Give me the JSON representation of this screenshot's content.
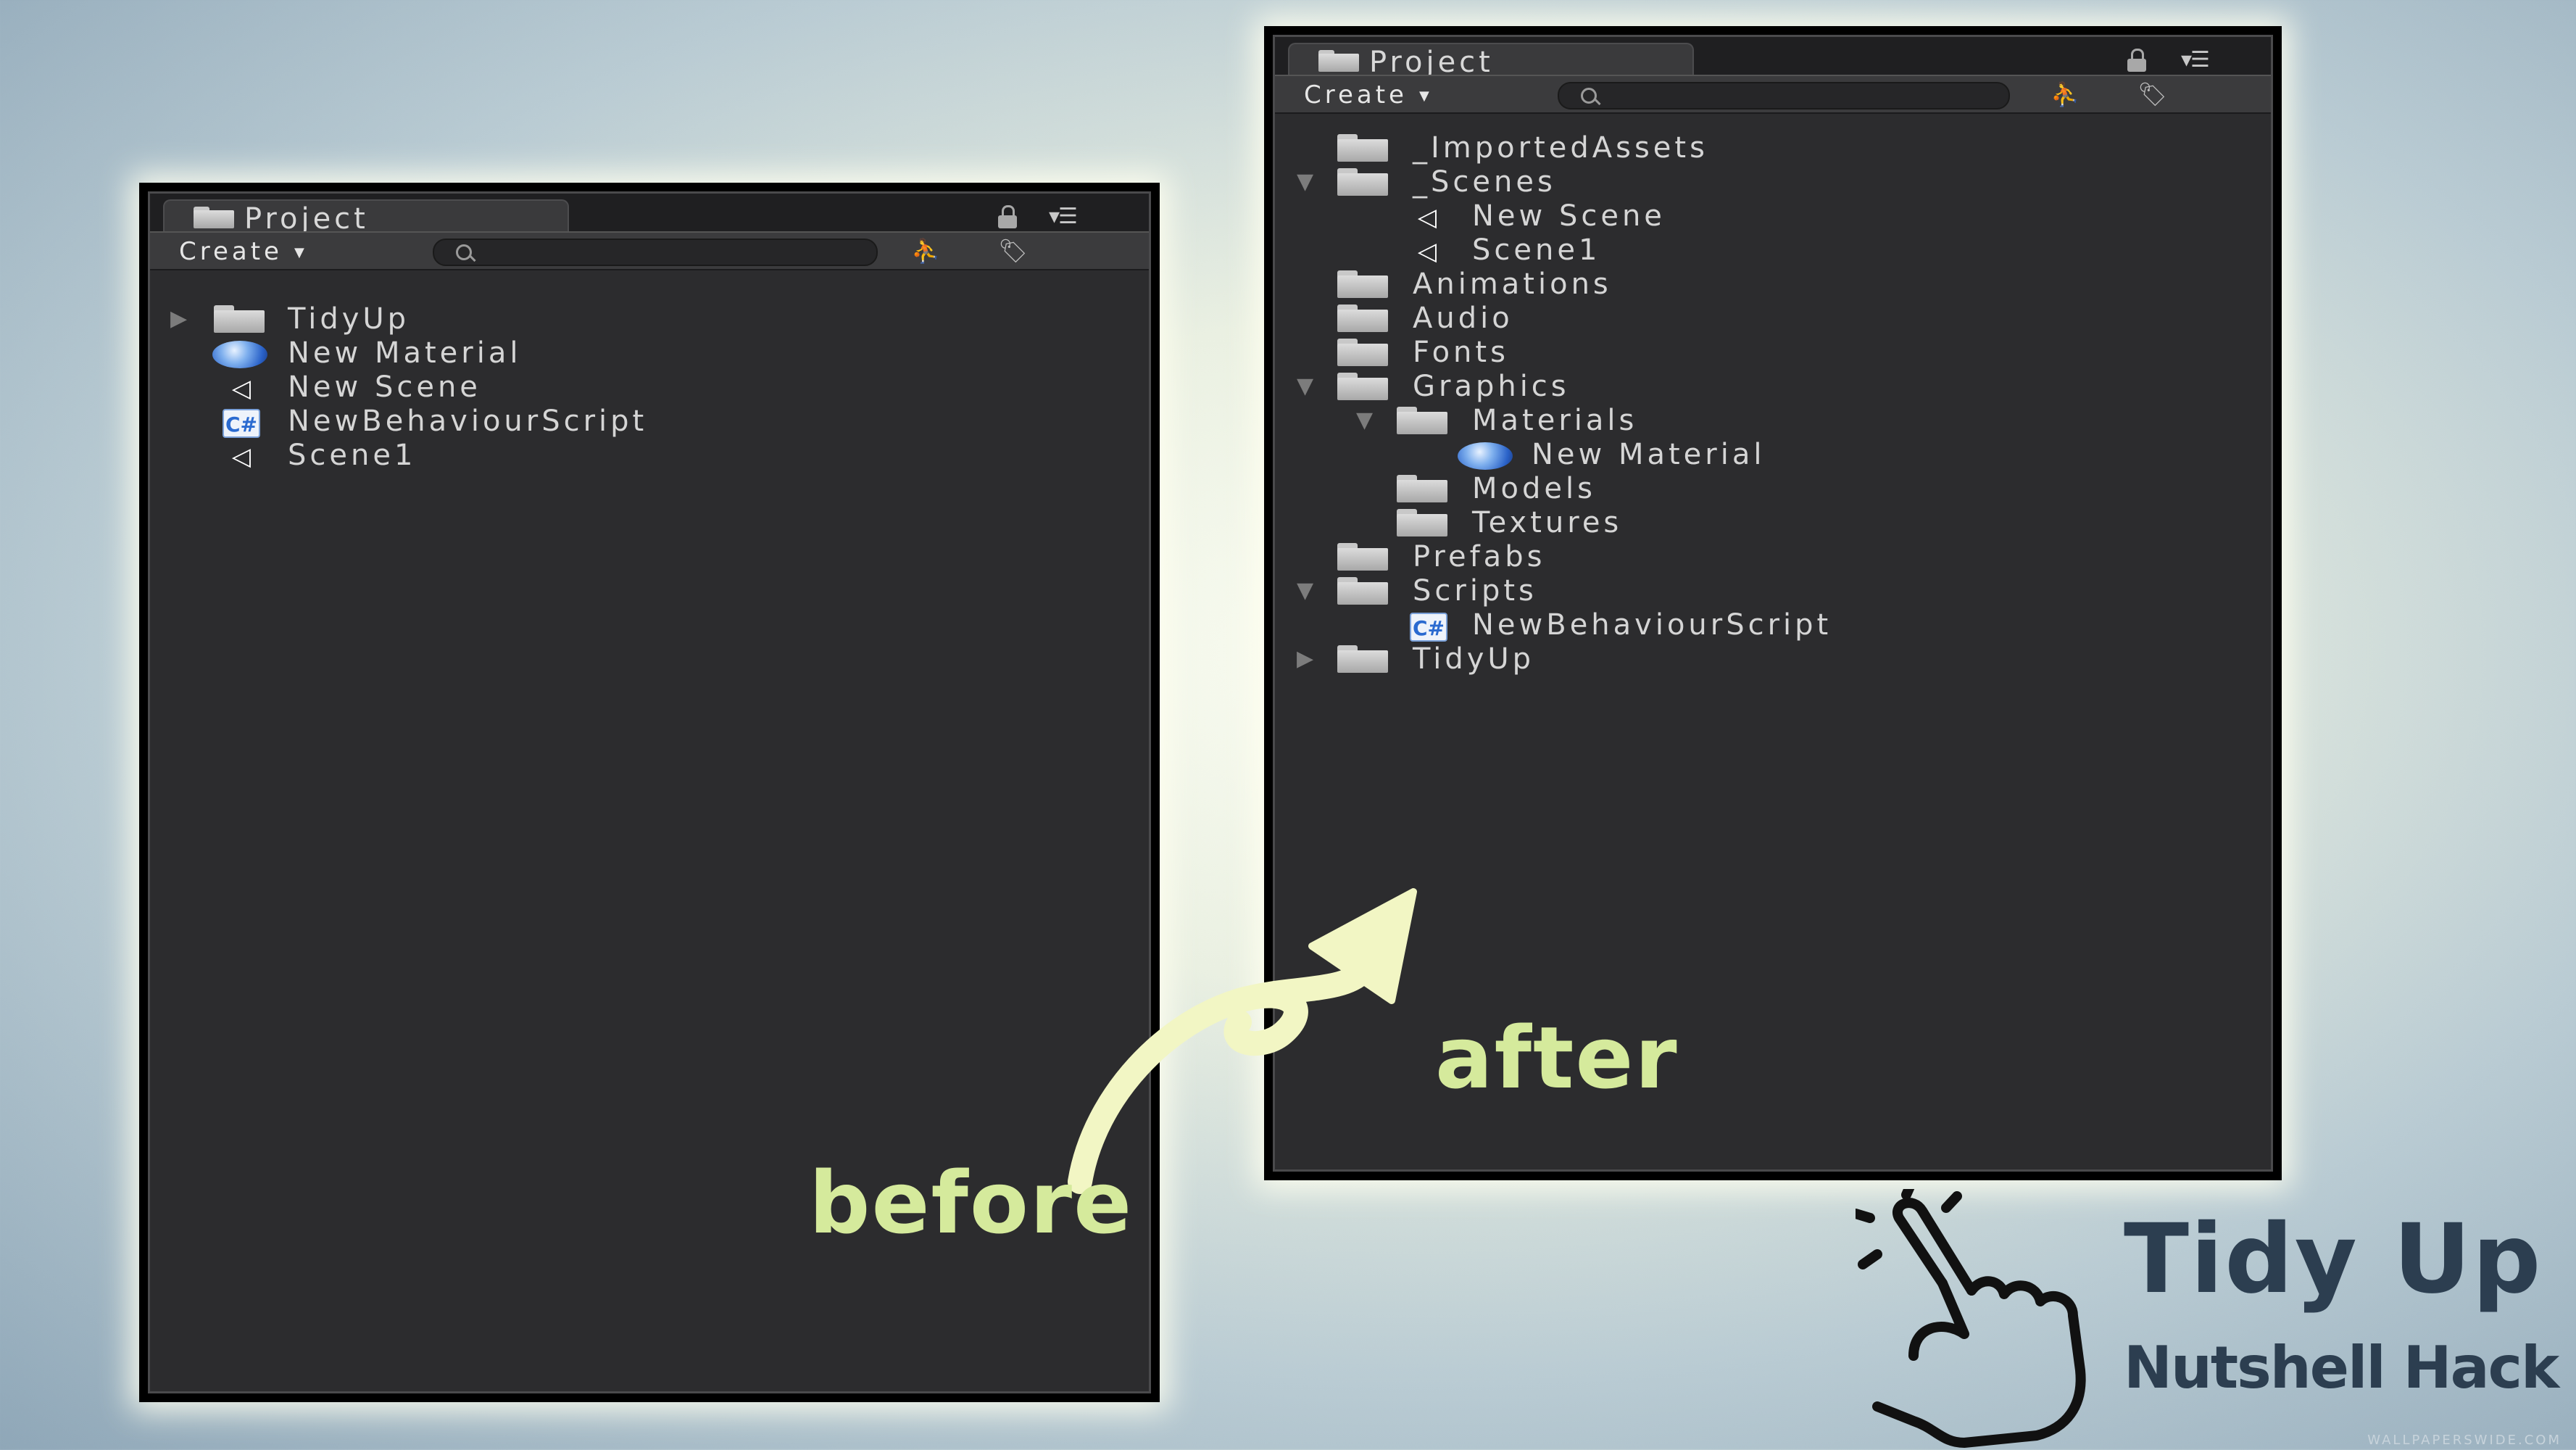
{
  "before_panel": {
    "tab_title": "Project",
    "create_label": "Create",
    "search_placeholder": "",
    "items": [
      {
        "label": "TidyUp",
        "icon": "folder-icon",
        "expander": "collapsed"
      },
      {
        "label": "New Material",
        "icon": "material-sphere-icon"
      },
      {
        "label": "New Scene",
        "icon": "unity-scene-icon"
      },
      {
        "label": "NewBehaviourScript",
        "icon": "csharp-script-icon"
      },
      {
        "label": "Scene1",
        "icon": "unity-scene-icon"
      }
    ]
  },
  "after_panel": {
    "tab_title": "Project",
    "create_label": "Create",
    "search_placeholder": "",
    "items": [
      {
        "label": "_ImportedAssets",
        "icon": "folder-icon",
        "depth": 0
      },
      {
        "label": "_Scenes",
        "icon": "folder-icon",
        "depth": 0,
        "expander": "expanded"
      },
      {
        "label": "New Scene",
        "icon": "unity-scene-icon",
        "depth": 1
      },
      {
        "label": "Scene1",
        "icon": "unity-scene-icon",
        "depth": 1
      },
      {
        "label": "Animations",
        "icon": "folder-icon",
        "depth": 0
      },
      {
        "label": "Audio",
        "icon": "folder-icon",
        "depth": 0
      },
      {
        "label": "Fonts",
        "icon": "folder-icon",
        "depth": 0
      },
      {
        "label": "Graphics",
        "icon": "folder-icon",
        "depth": 0,
        "expander": "expanded"
      },
      {
        "label": "Materials",
        "icon": "folder-icon",
        "depth": 1,
        "expander": "expanded"
      },
      {
        "label": "New Material",
        "icon": "material-sphere-icon",
        "depth": 2
      },
      {
        "label": "Models",
        "icon": "folder-icon",
        "depth": 1
      },
      {
        "label": "Textures",
        "icon": "folder-icon",
        "depth": 1
      },
      {
        "label": "Prefabs",
        "icon": "folder-icon",
        "depth": 0
      },
      {
        "label": "Scripts",
        "icon": "folder-icon",
        "depth": 0,
        "expander": "expanded"
      },
      {
        "label": "NewBehaviourScript",
        "icon": "csharp-script-icon",
        "depth": 1
      },
      {
        "label": "TidyUp",
        "icon": "folder-icon",
        "depth": 0,
        "expander": "collapsed"
      }
    ]
  },
  "captions": {
    "before": "before",
    "after": "after"
  },
  "brand": {
    "title": "Tidy Up",
    "subtitle": "Nutshell Hack"
  },
  "watermark": "WALLPAPERSWIDE.COM",
  "colors": {
    "caption": "#dcef9e",
    "brand": "#2c3e50",
    "panel_bg": "#2c2c2e"
  }
}
